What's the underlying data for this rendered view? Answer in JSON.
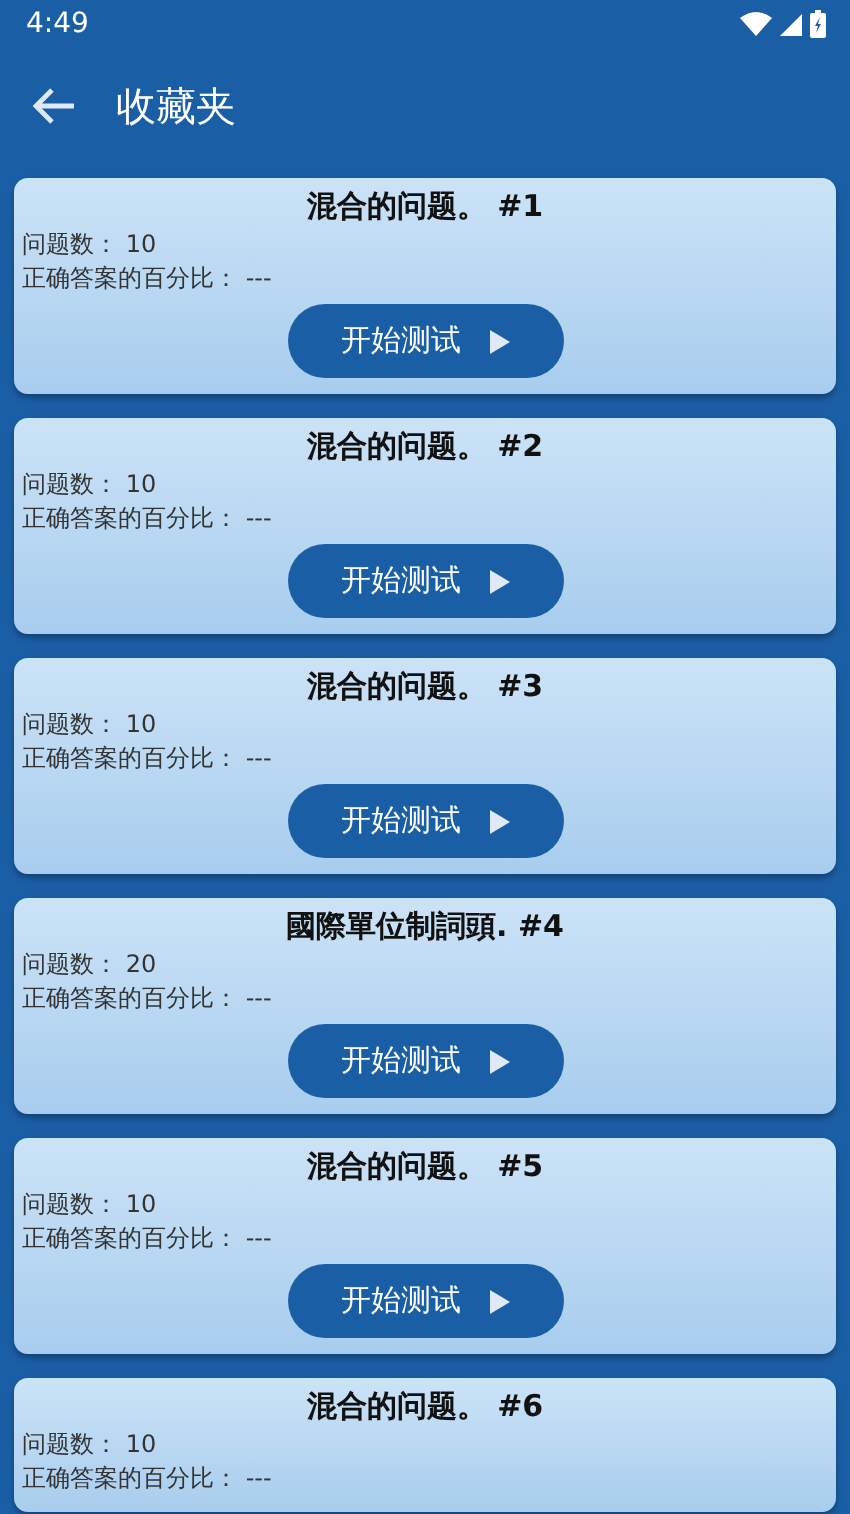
{
  "status_bar": {
    "time": "4:49"
  },
  "app_bar": {
    "title": "收藏夹"
  },
  "quizzes": [
    {
      "title": "混合的问题。 #1",
      "count": "问题数： 10",
      "percent": "正确答案的百分比： ---",
      "button": "开始测试"
    },
    {
      "title": "混合的问题。 #2",
      "count": "问题数： 10",
      "percent": "正确答案的百分比： ---",
      "button": "开始测试"
    },
    {
      "title": "混合的问题。 #3",
      "count": "问题数： 10",
      "percent": "正确答案的百分比： ---",
      "button": "开始测试"
    },
    {
      "title": "國際單位制詞頭. #4",
      "count": "问题数： 20",
      "percent": "正确答案的百分比： ---",
      "button": "开始测试"
    },
    {
      "title": "混合的问题。 #5",
      "count": "问题数： 10",
      "percent": "正确答案的百分比： ---",
      "button": "开始测试"
    },
    {
      "title": "混合的问题。 #6",
      "count": "问题数： 10",
      "percent": "正确答案的百分比： ---"
    }
  ]
}
